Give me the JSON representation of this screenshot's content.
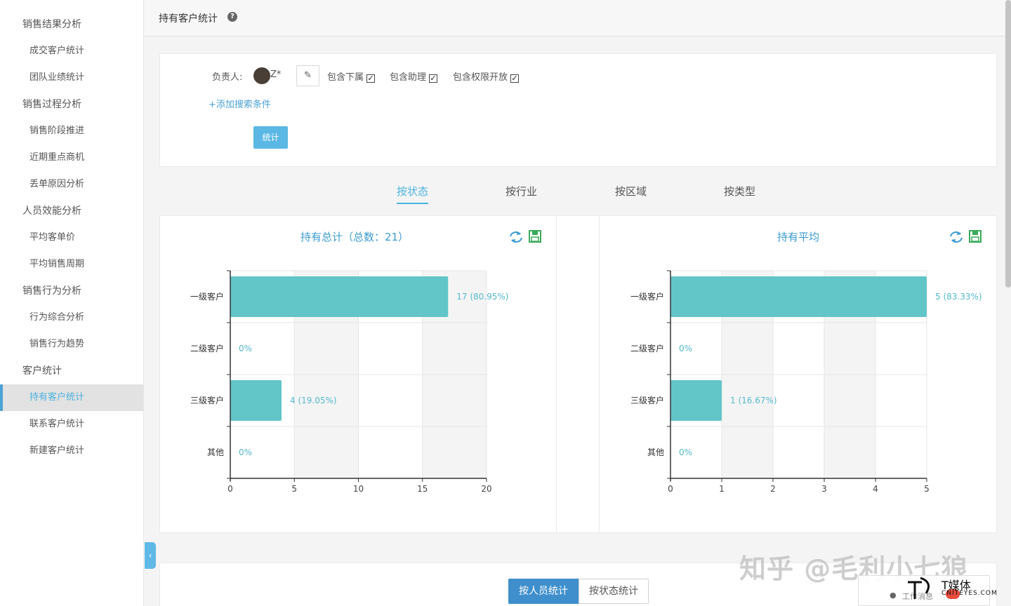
{
  "sidebar": {
    "items": [
      {
        "label": "销售结果分析",
        "level": 1
      },
      {
        "label": "成交客户统计",
        "level": 2
      },
      {
        "label": "团队业绩统计",
        "level": 2
      },
      {
        "label": "销售过程分析",
        "level": 1
      },
      {
        "label": "销售阶段推进",
        "level": 2
      },
      {
        "label": "近期重点商机",
        "level": 2
      },
      {
        "label": "丢单原因分析",
        "level": 2
      },
      {
        "label": "人员效能分析",
        "level": 1
      },
      {
        "label": "平均客单价",
        "level": 2
      },
      {
        "label": "平均销售周期",
        "level": 2
      },
      {
        "label": "销售行为分析",
        "level": 1
      },
      {
        "label": "行为综合分析",
        "level": 2
      },
      {
        "label": "销售行为趋势",
        "level": 2
      },
      {
        "label": "客户统计",
        "level": 1
      },
      {
        "label": "持有客户统计",
        "level": 2,
        "active": true
      },
      {
        "label": "联系客户统计",
        "level": 2
      },
      {
        "label": "新建客户统计",
        "level": 2
      }
    ],
    "collapse_glyph": "‹"
  },
  "header": {
    "title": "持有客户统计",
    "help_glyph": "?"
  },
  "filter": {
    "owner_label": "负责人:",
    "owner_name": "Z*",
    "edit_glyph": "✎",
    "options": [
      {
        "label": "包含下属",
        "checked": true
      },
      {
        "label": "包含助理",
        "checked": true
      },
      {
        "label": "包含权限开放",
        "checked": true
      }
    ],
    "check_glyph": "✓",
    "add_condition": "+添加搜索条件",
    "stat_button": "统计"
  },
  "tabs": [
    {
      "label": "按状态",
      "active": true
    },
    {
      "label": "按行业",
      "active": false
    },
    {
      "label": "按区域",
      "active": false
    },
    {
      "label": "按类型",
      "active": false
    }
  ],
  "chart_data": [
    {
      "type": "bar",
      "orientation": "horizontal",
      "title": "持有总计（总数：21）",
      "categories": [
        "一级客户",
        "二级客户",
        "三级客户",
        "其他"
      ],
      "values": [
        17,
        0,
        4,
        0
      ],
      "value_labels": [
        "17 (80.95%)",
        "0%",
        "4 (19.05%)",
        "0%"
      ],
      "xlim": [
        0,
        20
      ],
      "xticks": [
        0,
        5,
        10,
        15,
        20
      ],
      "bar_color": "#62c5c8",
      "grid": true
    },
    {
      "type": "bar",
      "orientation": "horizontal",
      "title": "持有平均",
      "categories": [
        "一级客户",
        "二级客户",
        "三级客户",
        "其他"
      ],
      "values": [
        5,
        0,
        1,
        0
      ],
      "value_labels": [
        "5 (83.33%)",
        "0%",
        "1 (16.67%)",
        "0%"
      ],
      "xlim": [
        0,
        5
      ],
      "xticks": [
        0,
        1,
        2,
        3,
        4,
        5
      ],
      "bar_color": "#62c5c8",
      "grid": true
    }
  ],
  "bottom": {
    "buttons": [
      {
        "label": "按人员统计",
        "active": true
      },
      {
        "label": "按状态统计",
        "active": false
      }
    ]
  },
  "overlay": {
    "watermark": "知乎 @毛利小七狼",
    "brand_name": "T媒体",
    "brand_site": "CNITEYES.COM",
    "work_label": "工作消息"
  },
  "colors": {
    "accent": "#4bb3e0",
    "bar": "#62c5c8",
    "primary_button": "#3f8fcc",
    "icon_green": "#3aaa5a"
  }
}
